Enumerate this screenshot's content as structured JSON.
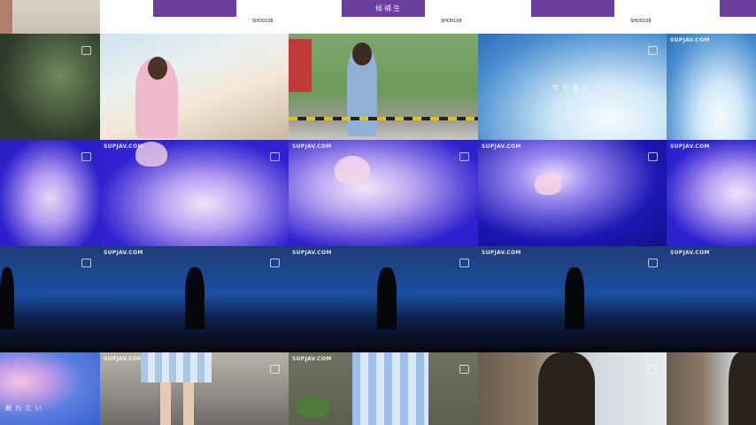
{
  "watermark": "SUPJAV.COM",
  "strip_code": "SHO0108",
  "purple_caption": "候補生",
  "sky_caption": "空 を 見 て",
  "jelly_caption": "触 れ た い"
}
